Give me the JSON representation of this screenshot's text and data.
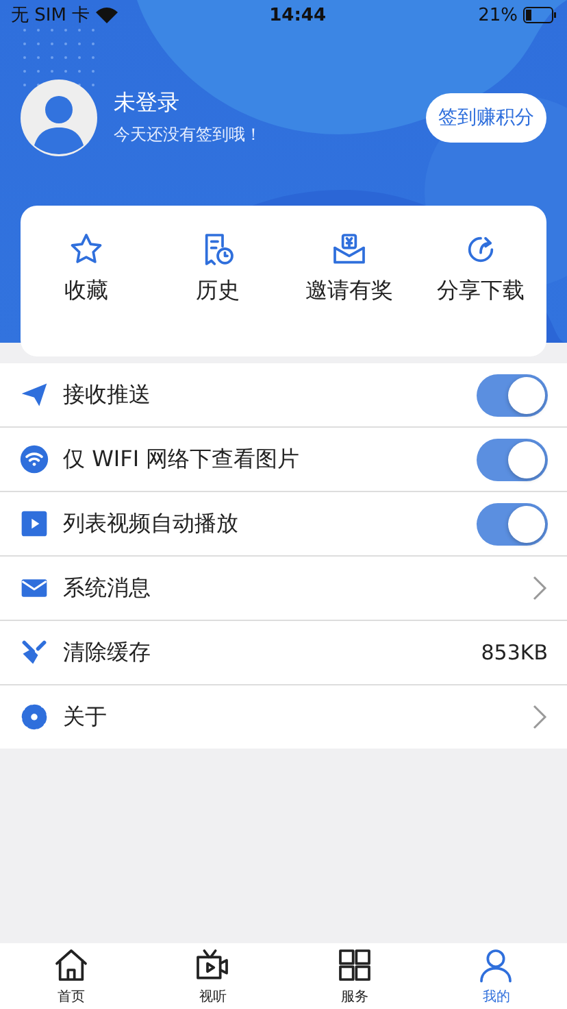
{
  "status_bar": {
    "carrier": "无 SIM 卡",
    "time": "14:44",
    "battery": "21%"
  },
  "profile": {
    "name": "未登录",
    "subtitle": "今天还没有签到哦！",
    "checkin_button": "签到赚积分"
  },
  "shortcuts": [
    {
      "label": "收藏"
    },
    {
      "label": "历史"
    },
    {
      "label": "邀请有奖"
    },
    {
      "label": "分享下载"
    }
  ],
  "settings": [
    {
      "kind": "toggle",
      "label": "接收推送",
      "on": true
    },
    {
      "kind": "toggle",
      "label": "仅 WIFI 网络下查看图片",
      "on": true
    },
    {
      "kind": "toggle",
      "label": "列表视频自动播放",
      "on": true
    },
    {
      "kind": "link",
      "label": "系统消息"
    },
    {
      "kind": "value",
      "label": "清除缓存",
      "value": "853KB"
    },
    {
      "kind": "link",
      "label": "关于"
    }
  ],
  "tab_bar": [
    {
      "label": "首页",
      "selected": false
    },
    {
      "label": "视听",
      "selected": false
    },
    {
      "label": "服务",
      "selected": false
    },
    {
      "label": "我的",
      "selected": true
    }
  ]
}
